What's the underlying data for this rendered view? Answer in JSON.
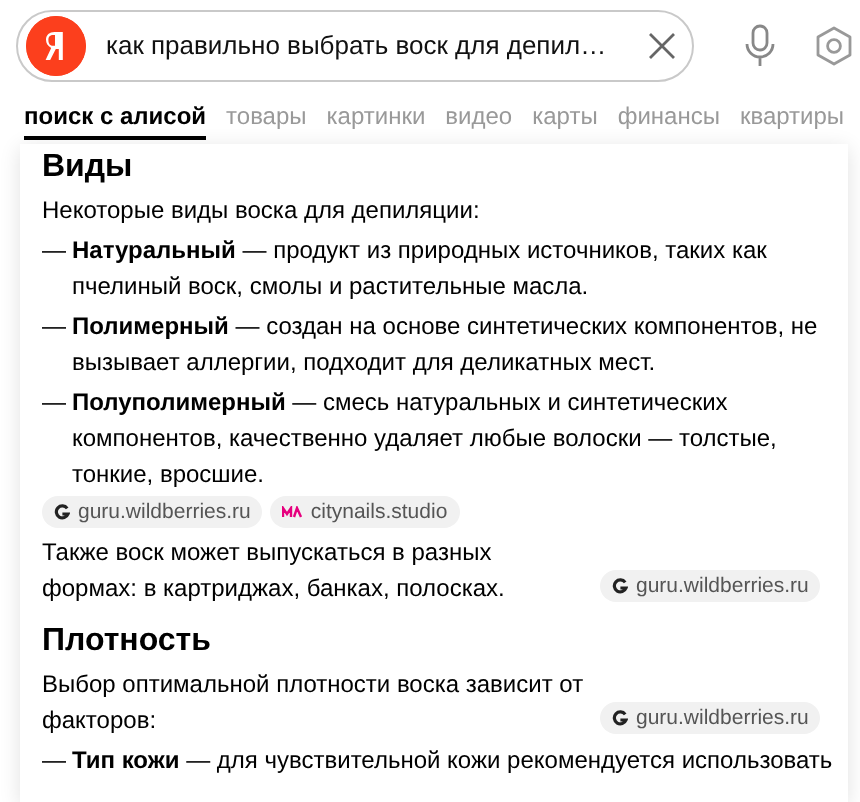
{
  "search": {
    "query": "как правильно выбрать воск для депил…"
  },
  "tabs": [
    {
      "label": "поиск с алисой",
      "selected": true
    },
    {
      "label": "товары",
      "selected": false
    },
    {
      "label": "картинки",
      "selected": false
    },
    {
      "label": "видео",
      "selected": false
    },
    {
      "label": "карты",
      "selected": false
    },
    {
      "label": "финансы",
      "selected": false
    },
    {
      "label": "квартиры",
      "selected": false
    }
  ],
  "sections": [
    {
      "heading": "Виды",
      "blocks": [
        {
          "kind": "paragraph",
          "text": "Некоторые виды воска для депиляции:"
        },
        {
          "kind": "list",
          "items": [
            {
              "marker": "—",
              "text": "**Натуральный** — продукт из природных источников, таких как пчелиный воск, смолы и растительные масла."
            },
            {
              "marker": "—",
              "text": "**Полимерный** — создан на основе синтетических компонентов, не вызывает аллергии, подходит для деликатных мест."
            },
            {
              "marker": "—",
              "text": "**Полуполимерный** — смесь натуральных и синтетических компонентов, качественно удаляет любые волоски — толстые, тонкие, вросшие."
            }
          ]
        },
        {
          "kind": "sources",
          "sources": [
            {
              "domain": "guru.wildberries.ru",
              "kind": "g"
            },
            {
              "domain": "citynails.studio",
              "kind": "brand"
            }
          ]
        },
        {
          "kind": "paragraph",
          "text": "Также воск может выпускаться в разных формах: в картриджах, банках, полосках.",
          "sources": [
            {
              "domain": "guru.wildberries.ru",
              "kind": "g"
            }
          ]
        }
      ]
    },
    {
      "heading": "Плотность",
      "blocks": [
        {
          "kind": "paragraph",
          "text": "Выбор оптимальной плотности воска зависит от факторов:",
          "sources": [
            {
              "domain": "guru.wildberries.ru",
              "kind": "g"
            }
          ]
        },
        {
          "kind": "list",
          "items": [
            {
              "marker": "—",
              "text": "**Тип кожи** — для чувствительной кожи рекомендуется использовать"
            }
          ]
        }
      ]
    }
  ]
}
